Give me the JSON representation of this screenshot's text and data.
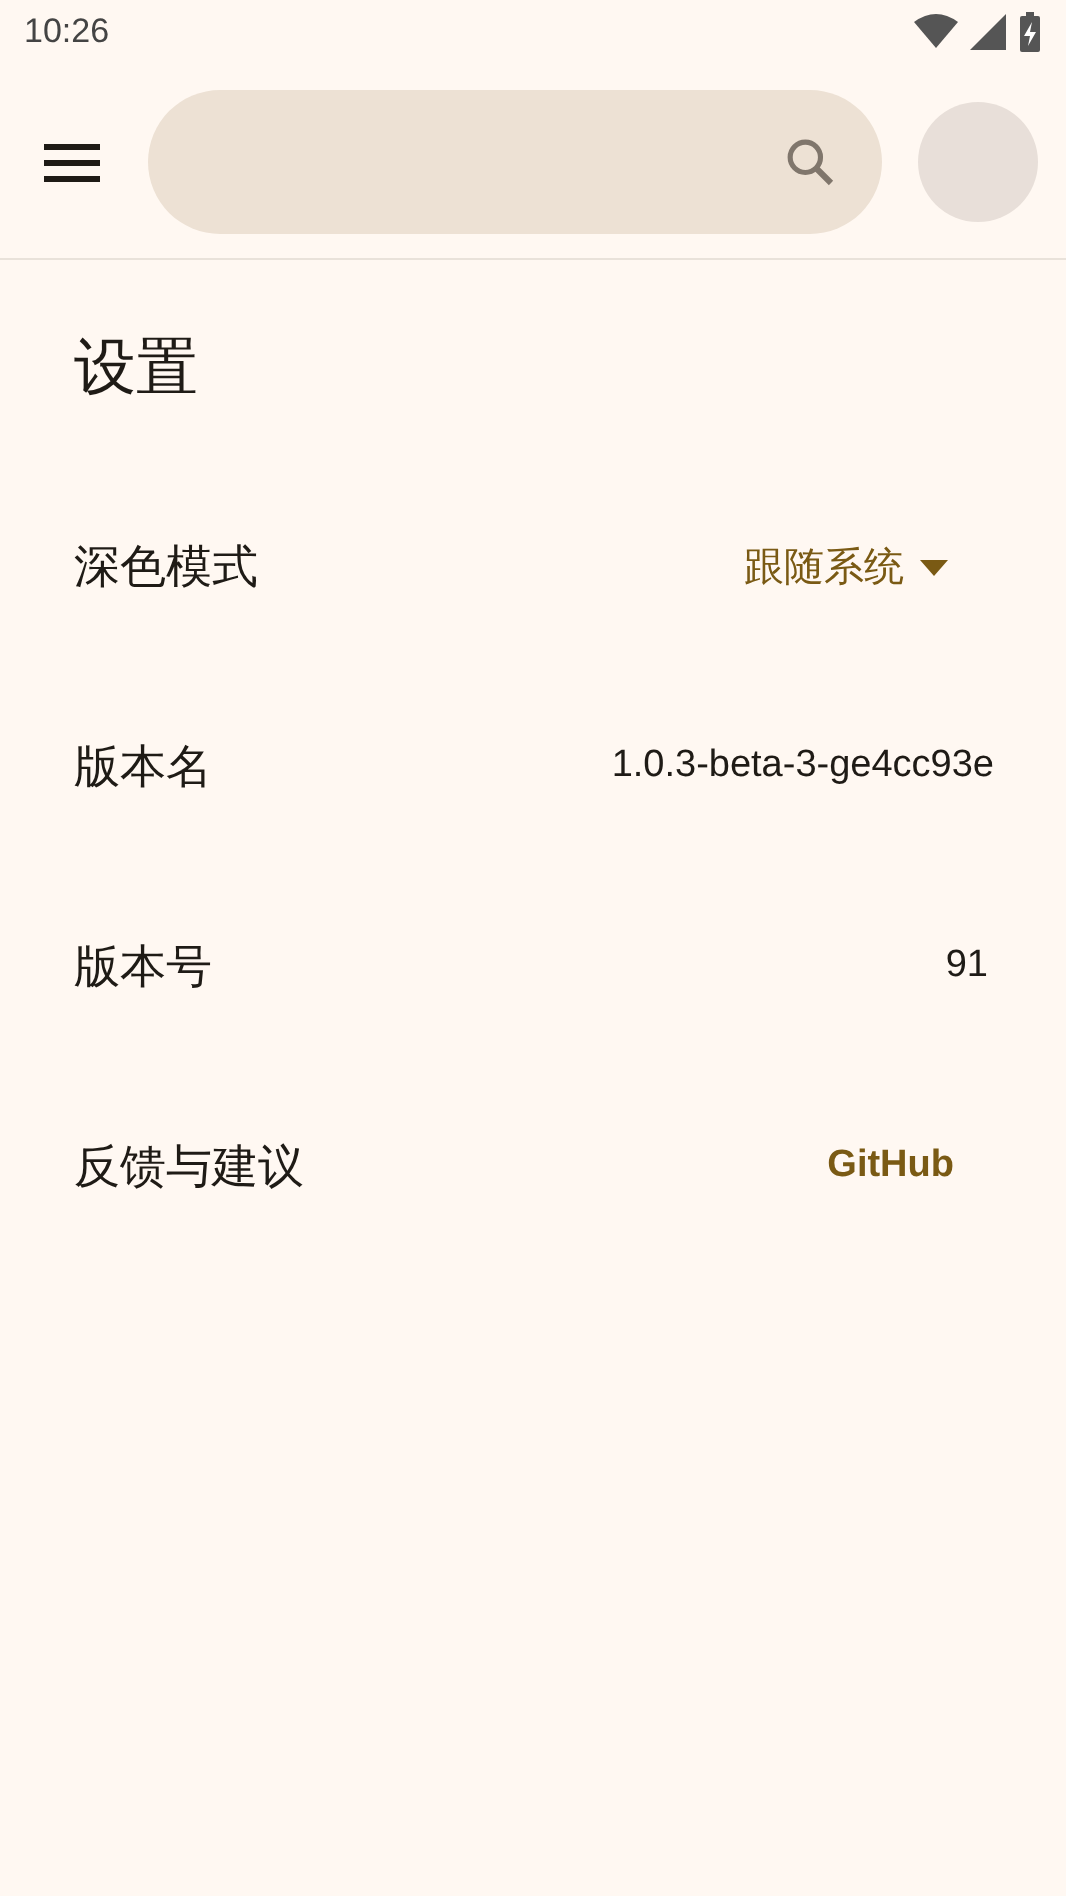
{
  "status_bar": {
    "time": "10:26"
  },
  "title": "设置",
  "settings": [
    {
      "kind": "dropdown",
      "label": "深色模式",
      "value": "跟随系统"
    },
    {
      "kind": "text",
      "label": "版本名",
      "value": "1.0.3-beta-3-ge4cc93e"
    },
    {
      "kind": "text",
      "label": "版本号",
      "value": "91"
    },
    {
      "kind": "link",
      "label": "反馈与建议",
      "value": "GitHub"
    }
  ]
}
